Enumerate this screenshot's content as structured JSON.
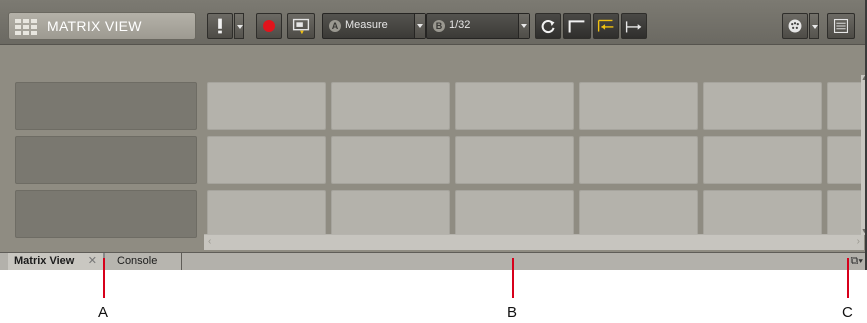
{
  "window": {
    "title": "MATRIX VIEW"
  },
  "toolbar": {
    "combo_a": {
      "badge": "A",
      "value": "Measure"
    },
    "combo_b": {
      "badge": "B",
      "value": "1/32"
    }
  },
  "tabs": [
    {
      "label": "Matrix View",
      "active": true,
      "close": "✕"
    },
    {
      "label": "Console",
      "active": false
    }
  ],
  "callouts": [
    {
      "label": "A"
    },
    {
      "label": "B"
    },
    {
      "label": "C"
    }
  ],
  "colors": {
    "record": "#e1141c",
    "accent": "#f0c010",
    "callout": "#d7001b"
  }
}
